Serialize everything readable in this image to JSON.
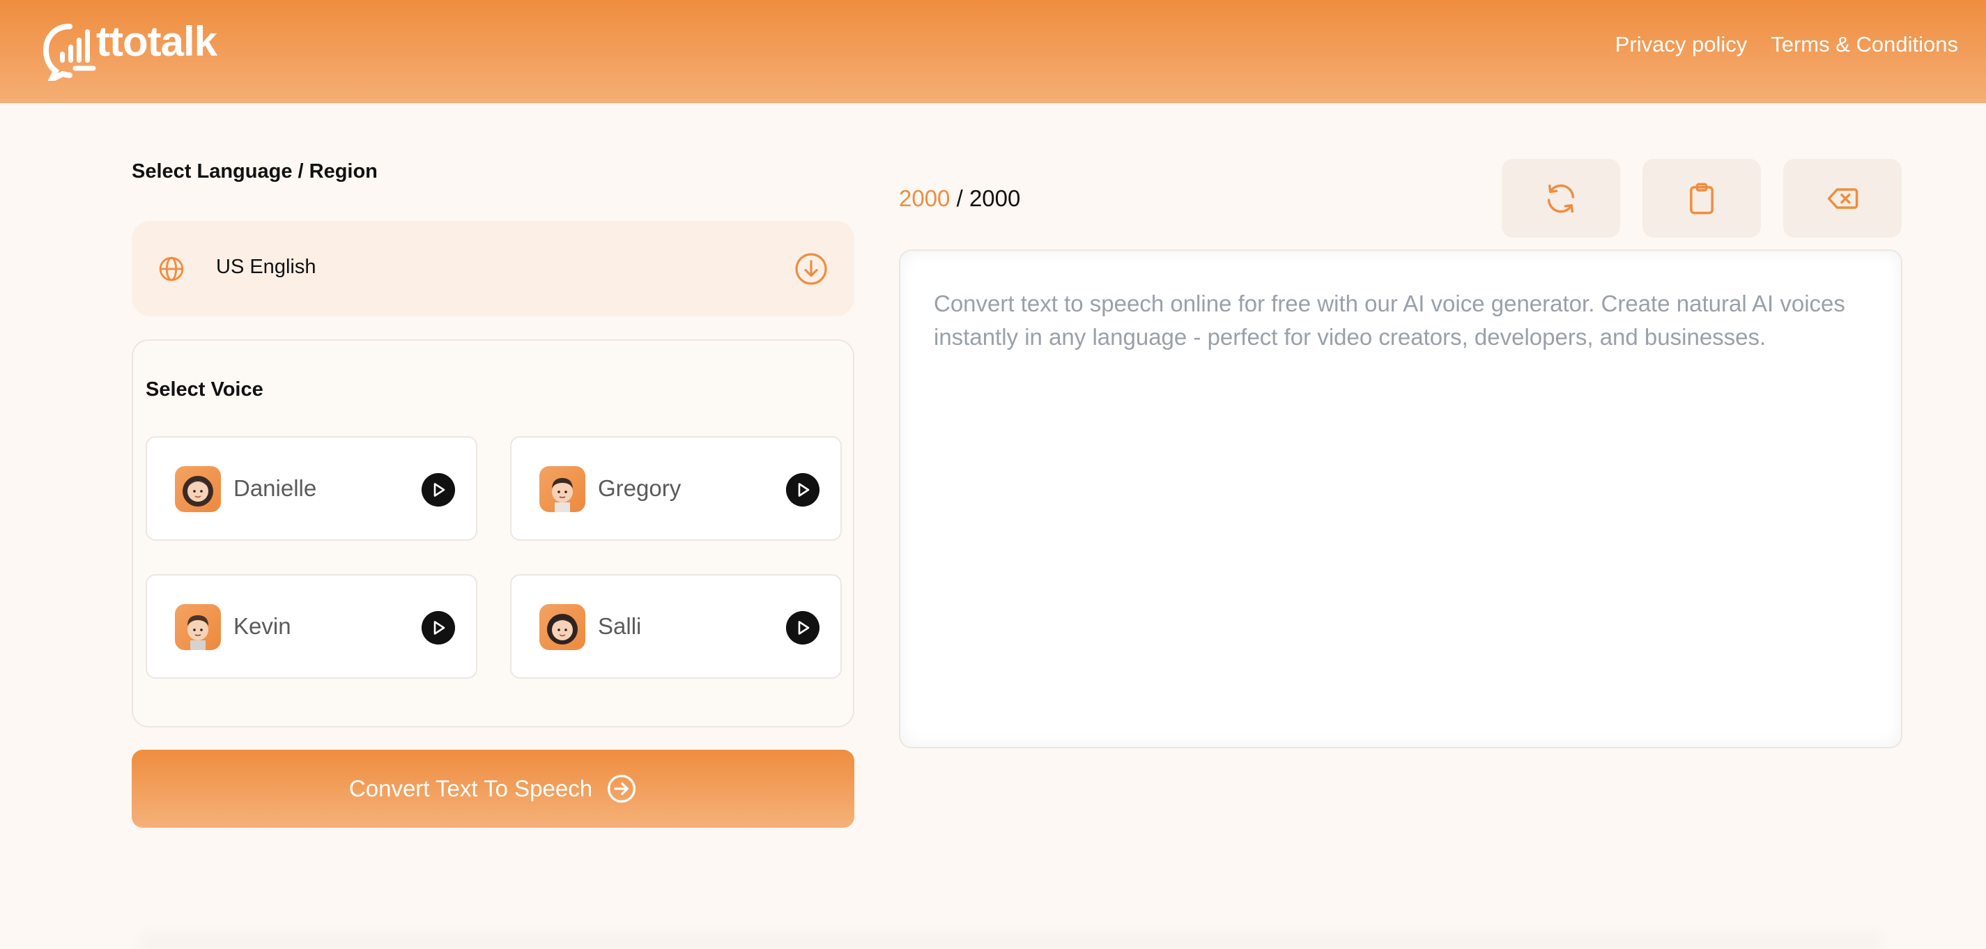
{
  "header": {
    "logo_text": "ttotalk",
    "nav": [
      {
        "label": "Privacy policy"
      },
      {
        "label": "Terms & Conditions"
      }
    ]
  },
  "language": {
    "title": "Select Language / Region",
    "selected": "US English"
  },
  "voices": {
    "title": "Select Voice",
    "items": [
      {
        "name": "Danielle"
      },
      {
        "name": "Gregory"
      },
      {
        "name": "Kevin"
      },
      {
        "name": "Salli"
      }
    ]
  },
  "convert_button": {
    "label": "Convert Text To Speech"
  },
  "counter": {
    "used": "2000",
    "separator": " / ",
    "limit": "2000"
  },
  "tools": [
    "refresh-icon",
    "clipboard-icon",
    "clear-backspace-icon"
  ],
  "editor": {
    "value": "",
    "placeholder": "Convert text to speech online for free with our AI voice generator. Create natural AI voices instantly in any language - perfect for video creators, developers, and businesses."
  },
  "colors": {
    "accent": "#ef8d3f",
    "background": "#fdf8f3"
  }
}
